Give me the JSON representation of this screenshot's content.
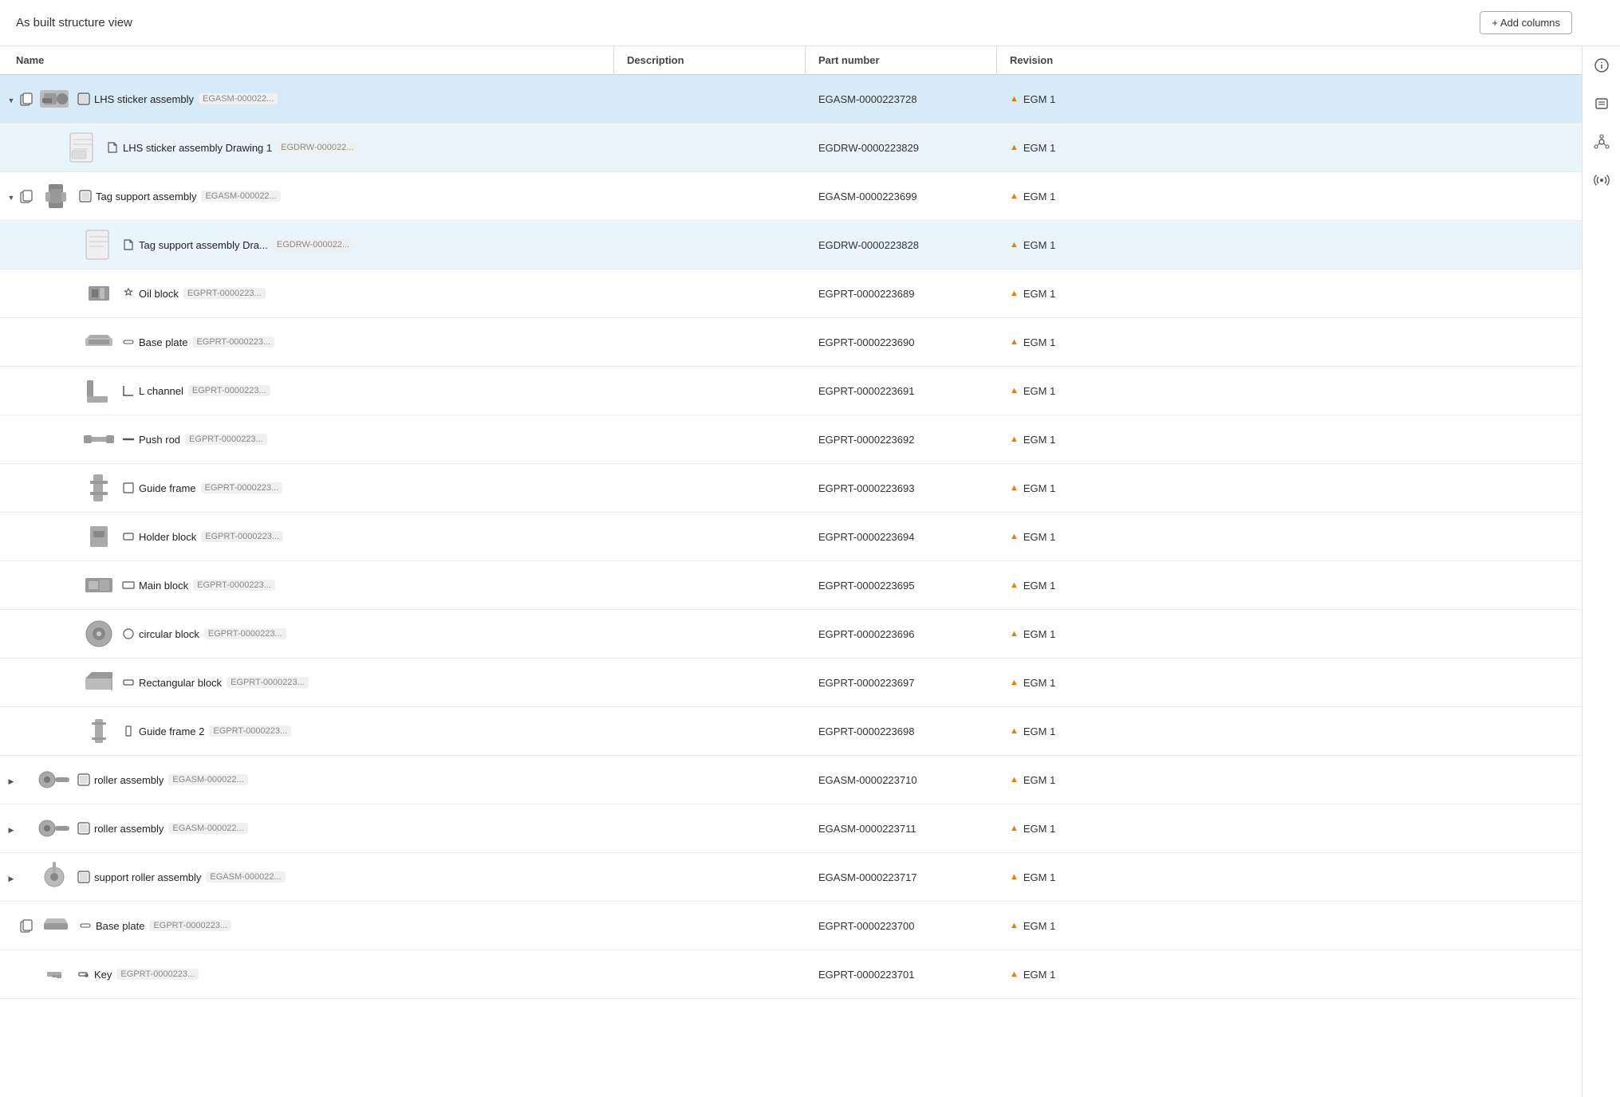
{
  "header": {
    "title": "As built structure view",
    "add_columns_label": "+ Add columns"
  },
  "columns": {
    "name": "Name",
    "description": "Description",
    "part_number": "Part number",
    "revision": "Revision"
  },
  "rows": [
    {
      "id": "row-lhs-sticker-asm",
      "level": 0,
      "expanded": true,
      "has_children": true,
      "selected": true,
      "icon_type": "assembly",
      "name": "LHS sticker assembly",
      "tag": "EGASM-000022...",
      "description": "",
      "part_number": "EGASM-0000223728",
      "revision": "EGM 1",
      "has_copy": true,
      "has_thumb": true,
      "thumb_shape": "assembly-complex"
    },
    {
      "id": "row-lhs-sticker-drawing",
      "level": 2,
      "expanded": false,
      "has_children": false,
      "selected": false,
      "sub_selected": true,
      "icon_type": "document",
      "name": "LHS sticker assembly Drawing 1",
      "tag": "EGDRW-000022...",
      "description": "",
      "part_number": "EGDRW-0000223829",
      "revision": "EGM 1",
      "has_copy": false,
      "has_thumb": true,
      "thumb_shape": "drawing"
    },
    {
      "id": "row-tag-support-asm",
      "level": 0,
      "expanded": true,
      "has_children": true,
      "selected": false,
      "icon_type": "assembly",
      "name": "Tag support assembly",
      "tag": "EGASM-000022...",
      "description": "",
      "part_number": "EGASM-0000223699",
      "revision": "EGM 1",
      "has_copy": true,
      "has_thumb": true,
      "thumb_shape": "tag-support"
    },
    {
      "id": "row-tag-support-drawing",
      "level": 2,
      "expanded": false,
      "has_children": false,
      "selected": false,
      "sub_selected": true,
      "icon_type": "document",
      "name": "Tag support assembly Dra...",
      "tag": "EGDRW-000022...",
      "description": "",
      "part_number": "EGDRW-0000223828",
      "revision": "EGM 1",
      "has_copy": false,
      "has_thumb": true,
      "thumb_shape": "drawing"
    },
    {
      "id": "row-oil-block",
      "level": 2,
      "expanded": false,
      "has_children": false,
      "selected": false,
      "icon_type": "part",
      "name": "Oil block",
      "tag": "EGPRT-0000223...",
      "description": "",
      "part_number": "EGPRT-0000223689",
      "revision": "EGM 1",
      "has_copy": false,
      "has_thumb": true,
      "thumb_shape": "oil-block"
    },
    {
      "id": "row-base-plate",
      "level": 2,
      "expanded": false,
      "has_children": false,
      "selected": false,
      "icon_type": "part",
      "name": "Base plate",
      "tag": "EGPRT-0000223...",
      "description": "",
      "part_number": "EGPRT-0000223690",
      "revision": "EGM 1",
      "has_copy": false,
      "has_thumb": true,
      "thumb_shape": "base-plate"
    },
    {
      "id": "row-l-channel",
      "level": 2,
      "expanded": false,
      "has_children": false,
      "selected": false,
      "icon_type": "part",
      "name": "L channel",
      "tag": "EGPRT-0000223...",
      "description": "",
      "part_number": "EGPRT-0000223691",
      "revision": "EGM 1",
      "has_copy": false,
      "has_thumb": true,
      "thumb_shape": "l-channel"
    },
    {
      "id": "row-push-rod",
      "level": 2,
      "expanded": false,
      "has_children": false,
      "selected": false,
      "icon_type": "part",
      "name": "Push rod",
      "tag": "EGPRT-0000223...",
      "description": "",
      "part_number": "EGPRT-0000223692",
      "revision": "EGM 1",
      "has_copy": false,
      "has_thumb": true,
      "thumb_shape": "push-rod"
    },
    {
      "id": "row-guide-frame",
      "level": 2,
      "expanded": false,
      "has_children": false,
      "selected": false,
      "icon_type": "part",
      "name": "Guide frame",
      "tag": "EGPRT-0000223...",
      "description": "",
      "part_number": "EGPRT-0000223693",
      "revision": "EGM 1",
      "has_copy": false,
      "has_thumb": true,
      "thumb_shape": "guide-frame"
    },
    {
      "id": "row-holder-block",
      "level": 2,
      "expanded": false,
      "has_children": false,
      "selected": false,
      "icon_type": "part",
      "name": "Holder block",
      "tag": "EGPRT-0000223...",
      "description": "",
      "part_number": "EGPRT-0000223694",
      "revision": "EGM 1",
      "has_copy": false,
      "has_thumb": true,
      "thumb_shape": "holder-block"
    },
    {
      "id": "row-main-block",
      "level": 2,
      "expanded": false,
      "has_children": false,
      "selected": false,
      "icon_type": "part",
      "name": "Main block",
      "tag": "EGPRT-0000223...",
      "description": "",
      "part_number": "EGPRT-0000223695",
      "revision": "EGM 1",
      "has_copy": false,
      "has_thumb": true,
      "thumb_shape": "main-block"
    },
    {
      "id": "row-circular-block",
      "level": 2,
      "expanded": false,
      "has_children": false,
      "selected": false,
      "icon_type": "part",
      "name": "circular block",
      "tag": "EGPRT-0000223...",
      "description": "",
      "part_number": "EGPRT-0000223696",
      "revision": "EGM 1",
      "has_copy": false,
      "has_thumb": true,
      "thumb_shape": "circular-block"
    },
    {
      "id": "row-rectangular-block",
      "level": 2,
      "expanded": false,
      "has_children": false,
      "selected": false,
      "icon_type": "part",
      "name": "Rectangular block",
      "tag": "EGPRT-0000223...",
      "description": "",
      "part_number": "EGPRT-0000223697",
      "revision": "EGM 1",
      "has_copy": false,
      "has_thumb": true,
      "thumb_shape": "rectangular-block"
    },
    {
      "id": "row-guide-frame-2",
      "level": 2,
      "expanded": false,
      "has_children": false,
      "selected": false,
      "icon_type": "part",
      "name": "Guide frame 2",
      "tag": "EGPRT-0000223...",
      "description": "",
      "part_number": "EGPRT-0000223698",
      "revision": "EGM 1",
      "has_copy": false,
      "has_thumb": true,
      "thumb_shape": "guide-frame-2"
    },
    {
      "id": "row-roller-asm-1",
      "level": 0,
      "expanded": false,
      "has_children": true,
      "selected": false,
      "icon_type": "assembly",
      "name": "roller assembly",
      "tag": "EGASM-000022...",
      "description": "",
      "part_number": "EGASM-0000223710",
      "revision": "EGM 1",
      "has_copy": false,
      "has_thumb": true,
      "thumb_shape": "roller"
    },
    {
      "id": "row-roller-asm-2",
      "level": 0,
      "expanded": false,
      "has_children": true,
      "selected": false,
      "icon_type": "assembly",
      "name": "roller assembly",
      "tag": "EGASM-000022...",
      "description": "",
      "part_number": "EGASM-0000223711",
      "revision": "EGM 1",
      "has_copy": false,
      "has_thumb": true,
      "thumb_shape": "roller"
    },
    {
      "id": "row-support-roller-asm",
      "level": 0,
      "expanded": false,
      "has_children": true,
      "selected": false,
      "icon_type": "assembly",
      "name": "support roller assembly",
      "tag": "EGASM-000022...",
      "description": "",
      "part_number": "EGASM-0000223717",
      "revision": "EGM 1",
      "has_copy": false,
      "has_thumb": true,
      "thumb_shape": "support-roller"
    },
    {
      "id": "row-base-plate-2",
      "level": 0,
      "expanded": false,
      "has_children": false,
      "selected": false,
      "icon_type": "part",
      "name": "Base plate",
      "tag": "EGPRT-0000223...",
      "description": "",
      "part_number": "EGPRT-0000223700",
      "revision": "EGM 1",
      "has_copy": true,
      "has_thumb": true,
      "thumb_shape": "base-plate-2"
    },
    {
      "id": "row-key",
      "level": 0,
      "expanded": false,
      "has_children": false,
      "selected": false,
      "icon_type": "part",
      "name": "Key",
      "tag": "EGPRT-0000223...",
      "description": "",
      "part_number": "EGPRT-0000223701",
      "revision": "EGM 1",
      "has_copy": false,
      "has_thumb": true,
      "thumb_shape": "key"
    }
  ],
  "right_panel": {
    "icons": [
      "info",
      "list",
      "network",
      "signal"
    ]
  }
}
